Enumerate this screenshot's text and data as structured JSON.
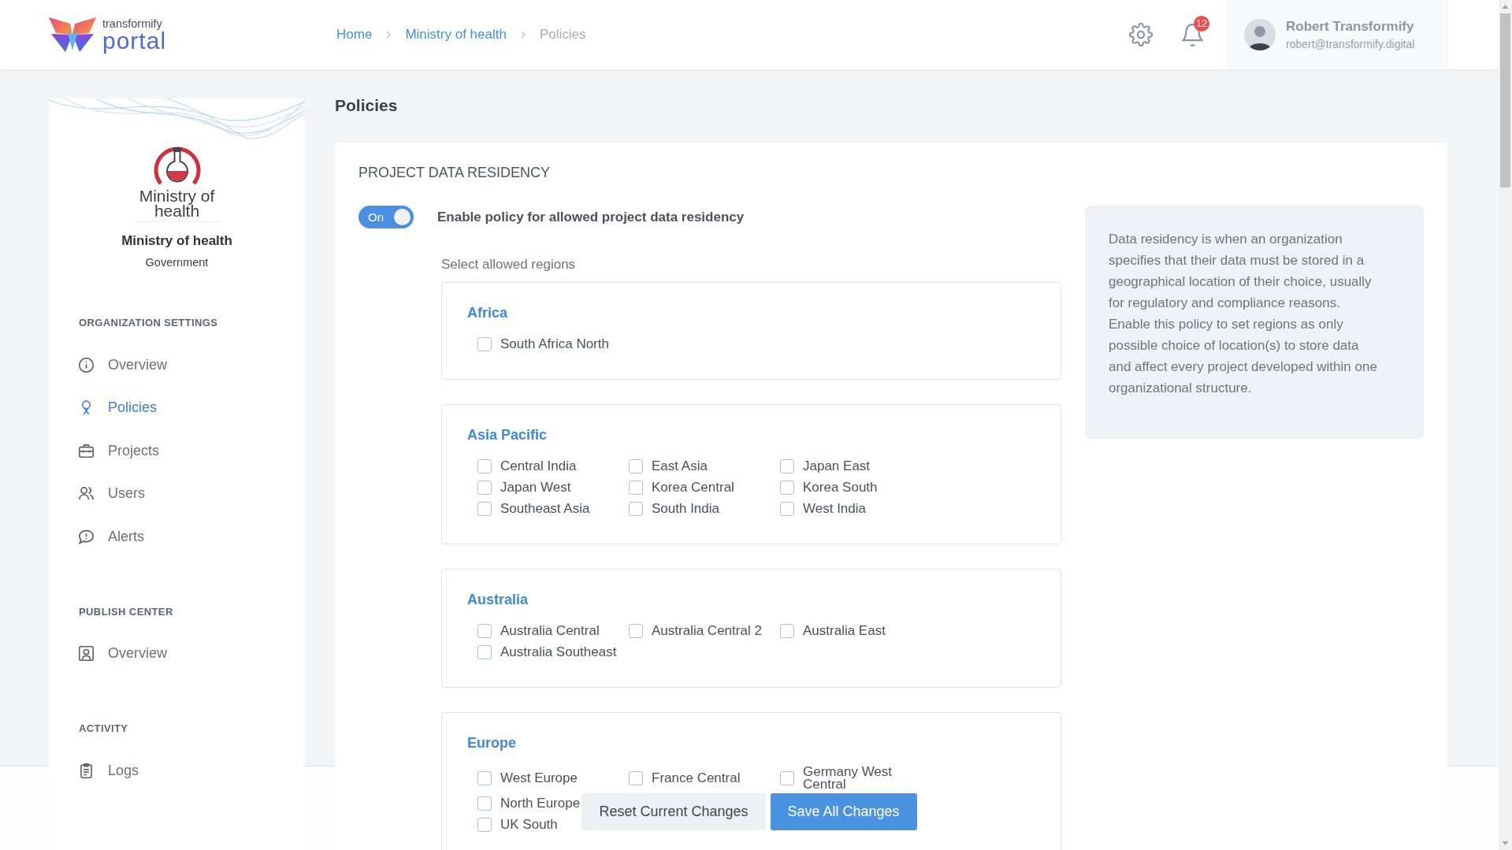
{
  "header": {
    "logo": {
      "top": "transformify",
      "bottom": "portal"
    },
    "breadcrumb": [
      {
        "label": "Home",
        "current": false
      },
      {
        "label": "Ministry of health",
        "current": false
      },
      {
        "label": "Policies",
        "current": true
      }
    ],
    "notifications": {
      "count": "12"
    },
    "user": {
      "name": "Robert Transformify",
      "email": "robert@transformify.digital"
    }
  },
  "sidebar": {
    "org": {
      "logo_lines": [
        "Ministry of",
        "health"
      ],
      "name": "Ministry of health",
      "type": "Government"
    },
    "sections": [
      {
        "title": "ORGANIZATION SETTINGS",
        "items": [
          {
            "label": "Overview",
            "kind": "overview",
            "selected": false
          },
          {
            "label": "Policies",
            "kind": "policies",
            "selected": true
          },
          {
            "label": "Projects",
            "kind": "projects",
            "selected": false
          },
          {
            "label": "Users",
            "kind": "users",
            "selected": false
          },
          {
            "label": "Alerts",
            "kind": "alerts",
            "selected": false
          }
        ]
      },
      {
        "title": "PUBLISH CENTER",
        "items": [
          {
            "label": "Overview",
            "kind": "publish",
            "selected": false
          }
        ]
      },
      {
        "title": "ACTIVITY",
        "items": [
          {
            "label": "Logs",
            "kind": "logs",
            "selected": false
          }
        ]
      }
    ]
  },
  "page": {
    "title": "Policies"
  },
  "policy": {
    "title": "PROJECT DATA RESIDENCY",
    "toggle": {
      "text": "On",
      "on": true
    },
    "label": "Enable policy for allowed project data residency",
    "regions_label": "Select allowed regions",
    "regions": [
      {
        "name": "Africa",
        "rows": [
          [
            {
              "label": "South Africa North",
              "checked": false
            }
          ]
        ]
      },
      {
        "name": "Asia Pacific",
        "rows": [
          [
            {
              "label": "Central India",
              "checked": false
            },
            {
              "label": "East Asia",
              "checked": false
            },
            {
              "label": "Japan East",
              "checked": false
            }
          ],
          [
            {
              "label": "Japan West",
              "checked": false
            },
            {
              "label": "Korea Central",
              "checked": false
            },
            {
              "label": "Korea South",
              "checked": false
            }
          ],
          [
            {
              "label": "Southeast Asia",
              "checked": false
            },
            {
              "label": "South India",
              "checked": false
            },
            {
              "label": "West India",
              "checked": false
            }
          ]
        ]
      },
      {
        "name": "Australia",
        "rows": [
          [
            {
              "label": "Australia Central",
              "checked": false
            },
            {
              "label": "Australia Central 2",
              "checked": false
            },
            {
              "label": "Australia East",
              "checked": false
            }
          ],
          [
            {
              "label": "Australia Southeast",
              "checked": false
            }
          ]
        ]
      },
      {
        "name": "Europe",
        "rows": [
          [
            {
              "label": "West Europe",
              "checked": false
            },
            {
              "label": "France Central",
              "checked": false
            },
            {
              "label": "Germany West Central",
              "checked": false
            }
          ],
          [
            {
              "label": "North Europe",
              "checked": false
            }
          ],
          [
            {
              "label": "UK South",
              "checked": false
            }
          ]
        ]
      }
    ],
    "info_lines": [
      "Data residency is when an organization",
      "specifies that their data must be stored in a",
      "geographical location of their choice, usually",
      "for regulatory and compliance reasons.",
      "Enable this policy to set regions as only",
      "possible choice of location(s) to store data",
      "and affect every project developed within one",
      "organizational structure."
    ]
  },
  "footer": {
    "buttons": [
      {
        "label": "Reset Current Changes",
        "kind": "secondary"
      },
      {
        "label": "Save All Changes",
        "kind": "primary"
      }
    ]
  }
}
